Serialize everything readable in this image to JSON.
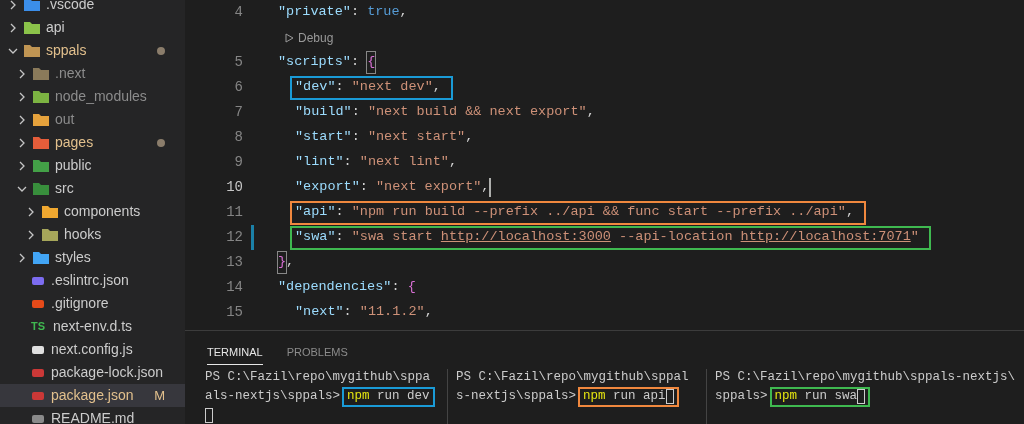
{
  "explorer": {
    "items": [
      {
        "name": ".vscode",
        "kind": "folder",
        "expanded": false,
        "selected": false,
        "modified": false,
        "dimmed": false,
        "color": "#3b8eea"
      },
      {
        "name": "api",
        "kind": "folder",
        "expanded": false,
        "selected": false,
        "modified": false,
        "dimmed": false,
        "color": "#8bc34a"
      },
      {
        "name": "sppals",
        "kind": "folder",
        "expanded": true,
        "selected": false,
        "modified": true,
        "dimmed": false,
        "color": "#c09553",
        "children": [
          {
            "name": ".next",
            "kind": "folder",
            "expanded": false,
            "selected": false,
            "modified": false,
            "dimmed": true,
            "color": "#8a7a5a"
          },
          {
            "name": "node_modules",
            "kind": "folder",
            "expanded": false,
            "selected": false,
            "modified": false,
            "dimmed": true,
            "color": "#7cb342"
          },
          {
            "name": "out",
            "kind": "folder",
            "expanded": false,
            "selected": false,
            "modified": false,
            "dimmed": true,
            "color": "#e6a23c"
          },
          {
            "name": "pages",
            "kind": "folder",
            "expanded": false,
            "selected": false,
            "modified": true,
            "dimmed": false,
            "color": "#e55d3a"
          },
          {
            "name": "public",
            "kind": "folder",
            "expanded": false,
            "selected": false,
            "modified": false,
            "dimmed": false,
            "color": "#43a047"
          },
          {
            "name": "src",
            "kind": "folder",
            "expanded": true,
            "selected": false,
            "modified": false,
            "dimmed": false,
            "color": "#388e3c",
            "children": [
              {
                "name": "components",
                "kind": "folder",
                "expanded": false,
                "selected": false,
                "modified": false,
                "dimmed": false,
                "color": "#f0a830"
              },
              {
                "name": "hooks",
                "kind": "folder",
                "expanded": false,
                "selected": false,
                "modified": false,
                "dimmed": false,
                "color": "#a6a65a"
              }
            ]
          },
          {
            "name": "styles",
            "kind": "folder",
            "expanded": false,
            "selected": false,
            "modified": false,
            "dimmed": false,
            "color": "#42a5f5"
          },
          {
            "name": ".eslintrc.json",
            "kind": "file",
            "selected": false,
            "modified": false,
            "dimmed": false,
            "color": "#7c6cf0"
          },
          {
            "name": ".gitignore",
            "kind": "file",
            "selected": false,
            "modified": false,
            "dimmed": false,
            "color": "#e64a19"
          },
          {
            "name": "next-env.d.ts",
            "kind": "file",
            "icon_text": "TS",
            "selected": false,
            "modified": false,
            "dimmed": false,
            "color": "#3fb950"
          },
          {
            "name": "next.config.js",
            "kind": "file",
            "selected": false,
            "modified": false,
            "dimmed": false,
            "color": "#e0e0e0"
          },
          {
            "name": "package-lock.json",
            "kind": "file",
            "selected": false,
            "modified": false,
            "dimmed": false,
            "color": "#cb3837"
          },
          {
            "name": "package.json",
            "kind": "file",
            "badge": "M",
            "selected": true,
            "modified": true,
            "dimmed": false,
            "color": "#cb3837"
          },
          {
            "name": "README.md",
            "kind": "file",
            "selected": false,
            "modified": false,
            "dimmed": false,
            "color": "#8a8a8a"
          }
        ]
      }
    ]
  },
  "editor": {
    "lines": [
      {
        "kind": "code",
        "number": "4",
        "current": false,
        "changed": false,
        "tokens": [
          {
            "kind": "key",
            "text": "\"private\""
          },
          {
            "kind": "punct",
            "text": ": "
          },
          {
            "kind": "keyword",
            "text": "true"
          },
          {
            "kind": "punct",
            "text": ","
          }
        ]
      },
      {
        "kind": "codelens",
        "text": "Debug"
      },
      {
        "kind": "code",
        "number": "5",
        "current": false,
        "changed": false,
        "tokens": [
          {
            "kind": "key",
            "text": "\"scripts\""
          },
          {
            "kind": "punct",
            "text": ": "
          },
          {
            "kind": "bracket",
            "text": "{",
            "matched": true
          }
        ],
        "children": [
          {
            "kind": "code",
            "number": "6",
            "current": false,
            "changed": false,
            "color": "#1a9bd7",
            "tokens": [
              {
                "kind": "key",
                "text": "\"dev\""
              },
              {
                "kind": "punct",
                "text": ": "
              },
              {
                "kind": "string",
                "text": "\"next dev\""
              },
              {
                "kind": "punct",
                "text": ","
              }
            ]
          },
          {
            "kind": "code",
            "number": "7",
            "current": false,
            "changed": false,
            "tokens": [
              {
                "kind": "key",
                "text": "\"build\""
              },
              {
                "kind": "punct",
                "text": ": "
              },
              {
                "kind": "string",
                "text": "\"next build && next export\""
              },
              {
                "kind": "punct",
                "text": ","
              }
            ]
          },
          {
            "kind": "code",
            "number": "8",
            "current": false,
            "changed": false,
            "tokens": [
              {
                "kind": "key",
                "text": "\"start\""
              },
              {
                "kind": "punct",
                "text": ": "
              },
              {
                "kind": "string",
                "text": "\"next start\""
              },
              {
                "kind": "punct",
                "text": ","
              }
            ]
          },
          {
            "kind": "code",
            "number": "9",
            "current": false,
            "changed": false,
            "tokens": [
              {
                "kind": "key",
                "text": "\"lint\""
              },
              {
                "kind": "punct",
                "text": ": "
              },
              {
                "kind": "string",
                "text": "\"next lint\""
              },
              {
                "kind": "punct",
                "text": ","
              }
            ]
          },
          {
            "kind": "code",
            "number": "10",
            "current": true,
            "changed": false,
            "tokens": [
              {
                "kind": "key",
                "text": "\"export\""
              },
              {
                "kind": "punct",
                "text": ": "
              },
              {
                "kind": "string",
                "text": "\"next export\""
              },
              {
                "kind": "punct",
                "text": ","
              }
            ]
          },
          {
            "kind": "code",
            "number": "11",
            "current": false,
            "changed": false,
            "color": "#f0883e",
            "tokens": [
              {
                "kind": "key",
                "text": "\"api\""
              },
              {
                "kind": "punct",
                "text": ": "
              },
              {
                "kind": "string",
                "text": "\"npm run build --prefix ../api && func start --prefix ../api\""
              },
              {
                "kind": "punct",
                "text": ","
              }
            ]
          },
          {
            "kind": "code",
            "number": "12",
            "current": false,
            "changed": true,
            "color": "#3fb950",
            "tokens": [
              {
                "kind": "key",
                "text": "\"swa\""
              },
              {
                "kind": "punct",
                "text": ": "
              },
              {
                "kind": "string",
                "text": "\"swa start "
              },
              {
                "kind": "link",
                "text": "http://localhost:3000"
              },
              {
                "kind": "string",
                "text": " --api-location "
              },
              {
                "kind": "link",
                "text": "http://localhost:7071"
              },
              {
                "kind": "string",
                "text": "\""
              }
            ]
          }
        ]
      },
      {
        "kind": "code",
        "number": "13",
        "current": false,
        "changed": false,
        "tokens": [
          {
            "kind": "bracket",
            "text": "}",
            "matched": true
          },
          {
            "kind": "punct",
            "text": ","
          }
        ]
      },
      {
        "kind": "code",
        "number": "14",
        "current": false,
        "changed": false,
        "tokens": [
          {
            "kind": "key",
            "text": "\"dependencies\""
          },
          {
            "kind": "punct",
            "text": ": "
          },
          {
            "kind": "bracket",
            "text": "{",
            "matched": false
          }
        ],
        "children": [
          {
            "kind": "code",
            "number": "15",
            "current": false,
            "changed": false,
            "tokens": [
              {
                "kind": "key",
                "text": "\"next\""
              },
              {
                "kind": "punct",
                "text": ": "
              },
              {
                "kind": "string",
                "text": "\"11.1.2\""
              },
              {
                "kind": "punct",
                "text": ","
              }
            ]
          }
        ]
      }
    ]
  },
  "panel": {
    "tabs": [
      {
        "label": "TERMINAL",
        "selected": true
      },
      {
        "label": "PROBLEMS",
        "selected": false
      }
    ],
    "terminals": [
      {
        "prompt": [
          "PS C:\\Fazil\\repo\\mygithub\\sppa",
          "als-nextjs\\sppals>"
        ],
        "program": "npm",
        "args": " run dev",
        "color": "#1a9bd7",
        "cursor_on_new_line": true
      },
      {
        "prompt": [
          "PS C:\\Fazil\\repo\\mygithub\\sppal",
          "s-nextjs\\sppals>"
        ],
        "program": "npm",
        "args": " run api",
        "color": "#f0883e",
        "cursor_on_new_line": false
      },
      {
        "prompt": [
          "PS C:\\Fazil\\repo\\mygithub\\sppals-nextjs\\",
          "sppals>"
        ],
        "program": "npm",
        "args": " run swa",
        "color": "#3fb950",
        "cursor_on_new_line": false
      }
    ]
  }
}
